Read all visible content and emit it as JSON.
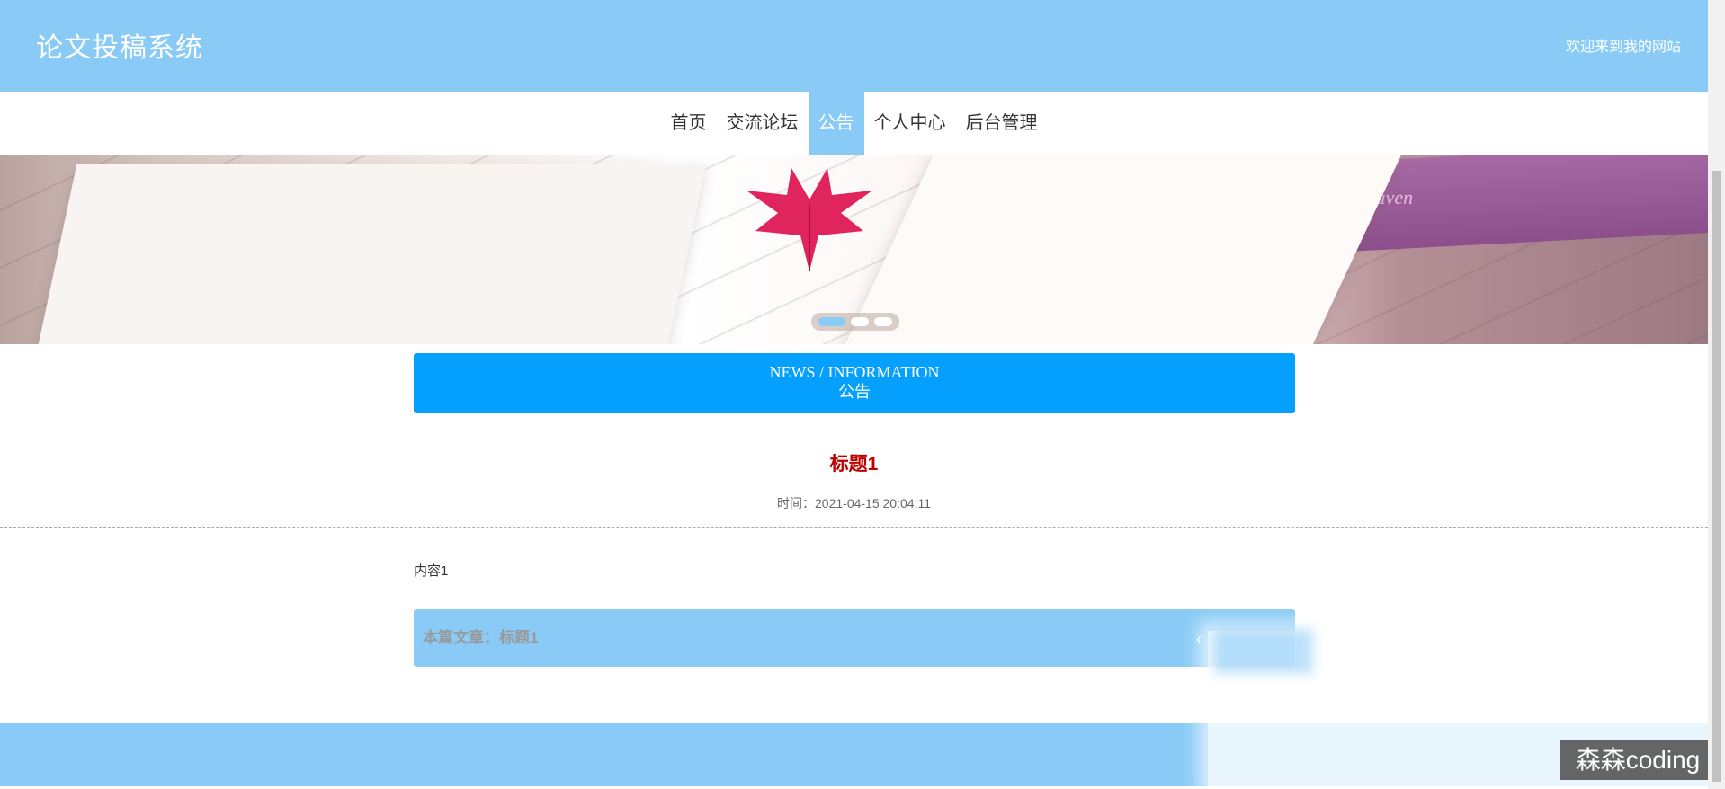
{
  "site": {
    "title": "论文投稿系统",
    "welcome": "欢迎来到我的网站"
  },
  "nav": {
    "items": [
      {
        "label": "首页",
        "active": false
      },
      {
        "label": "交流论坛",
        "active": false
      },
      {
        "label": "公告",
        "active": true
      },
      {
        "label": "个人中心",
        "active": false
      },
      {
        "label": "后台管理",
        "active": false
      }
    ]
  },
  "banner": {
    "book_text": "Seventh Heaven",
    "slide_count": 3,
    "active_slide": 1
  },
  "section": {
    "title_en": "NEWS / INFORMATION",
    "title_cn": "公告"
  },
  "article": {
    "title": "标题1",
    "time": "时间：2021-04-15 20:04:11",
    "content": "内容1",
    "current_label": "本篇文章：标题1"
  },
  "icons": {
    "back": "chevron-left-icon",
    "leaf": "maple-leaf-icon"
  },
  "watermark": "森森coding",
  "colors": {
    "topbar": "#89cbf6",
    "section_header": "#05a0fe",
    "article_title": "#c00000",
    "footer": "#89cbf6"
  }
}
